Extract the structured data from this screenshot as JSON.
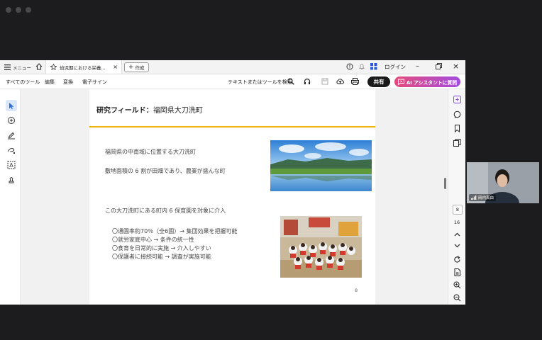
{
  "tabbar": {
    "menu_label": "メニュー",
    "tab_title": "幼児期における栄養...",
    "new_tab_label": "作成",
    "login_label": "ログイン"
  },
  "toolbar": {
    "all_tools": "すべてのツール",
    "edit": "編集",
    "convert": "変換",
    "esign": "電子サイン",
    "search": "テキストまたはツールを検索",
    "share": "共有",
    "ai_assistant": "AI アシスタントに質問"
  },
  "slide": {
    "title_bold": "研究フィールド：",
    "title_rest": "福岡県大刀洗町",
    "line1": "福岡県の中南域に位置する大刀洗町",
    "line2": "敷地面積の 6 割が田畑であり、農業が盛んな町",
    "line3": "この大刀洗町にある町内 6 保育園を対象に介入",
    "bullets": [
      "〇通園率約70％（全6園）→ 集団効果を把握可能",
      "〇就労家庭中心 → 条件の統一性",
      "〇食育を日常的に実施 → 介入しやすい",
      "〇保護者に接続可能 → 調査が実施可能"
    ],
    "page_number": "8"
  },
  "pager": {
    "current": "8",
    "total": "16"
  },
  "video": {
    "name": "岡内真由"
  },
  "colors": {
    "accent_line": "#f0b400",
    "share_bg": "#1a1a1a",
    "ai_bg": "#b34fd1",
    "select_tool": "#2f6fd6"
  }
}
